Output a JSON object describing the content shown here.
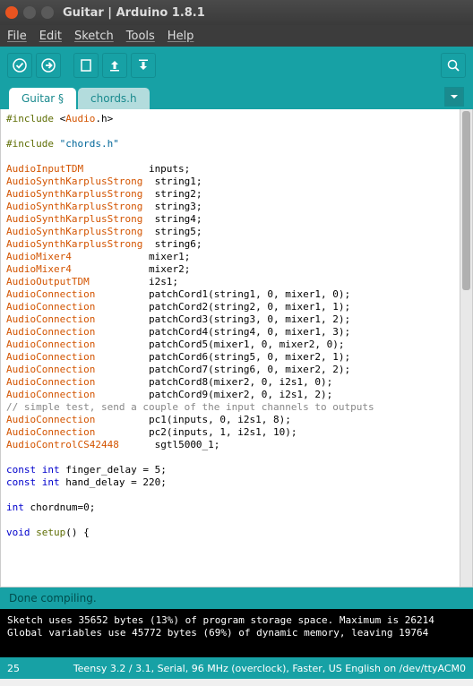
{
  "window": {
    "title": "Guitar | Arduino 1.8.1"
  },
  "menu": {
    "file": "File",
    "edit": "Edit",
    "sketch": "Sketch",
    "tools": "Tools",
    "help": "Help"
  },
  "tabs": {
    "active": "Guitar §",
    "inactive": "chords.h"
  },
  "code": {
    "l1a": "#include",
    "l1b": " <",
    "l1c": "Audio",
    "l1d": ".h>",
    "l2a": "#include",
    "l2b": " ",
    "l2c": "\"chords.h\"",
    "d1a": "AudioInputTDM",
    "d1b": "           inputs;",
    "d2a": "AudioSynthKarplusStrong",
    "d2b": "  string1;",
    "d3a": "AudioSynthKarplusStrong",
    "d3b": "  string2;",
    "d4a": "AudioSynthKarplusStrong",
    "d4b": "  string3;",
    "d5a": "AudioSynthKarplusStrong",
    "d5b": "  string4;",
    "d6a": "AudioSynthKarplusStrong",
    "d6b": "  string5;",
    "d7a": "AudioSynthKarplusStrong",
    "d7b": "  string6;",
    "d8a": "AudioMixer4",
    "d8b": "             mixer1;",
    "d9a": "AudioMixer4",
    "d9b": "             mixer2;",
    "d10a": "AudioOutputTDM",
    "d10b": "          i2s1;",
    "d11a": "AudioConnection",
    "d11b": "         patchCord1(string1, 0, mixer1, 0);",
    "d12a": "AudioConnection",
    "d12b": "         patchCord2(string2, 0, mixer1, 1);",
    "d13a": "AudioConnection",
    "d13b": "         patchCord3(string3, 0, mixer1, 2);",
    "d14a": "AudioConnection",
    "d14b": "         patchCord4(string4, 0, mixer1, 3);",
    "d15a": "AudioConnection",
    "d15b": "         patchCord5(mixer1, 0, mixer2, 0);",
    "d16a": "AudioConnection",
    "d16b": "         patchCord6(string5, 0, mixer2, 1);",
    "d17a": "AudioConnection",
    "d17b": "         patchCord7(string6, 0, mixer2, 2);",
    "d18a": "AudioConnection",
    "d18b": "         patchCord8(mixer2, 0, i2s1, 0);",
    "d19a": "AudioConnection",
    "d19b": "         patchCord9(mixer2, 0, i2s1, 2);",
    "cmt": "// simple test, send a couple of the input channels to outputs",
    "d20a": "AudioConnection",
    "d20b": "         pc1(inputs, 0, i2s1, 8);",
    "d21a": "AudioConnection",
    "d21b": "         pc2(inputs, 1, i2s1, 10);",
    "d22a": "AudioControlCS42448",
    "d22b": "      sgtl5000_1;",
    "c1a": "const",
    "c1b": " ",
    "c1c": "int",
    "c1d": " finger_delay = 5;",
    "c2a": "const",
    "c2b": " ",
    "c2c": "int",
    "c2d": " hand_delay = 220;",
    "c3a": "int",
    "c3b": " chordnum=0;",
    "s1a": "void",
    "s1b": " ",
    "s1c": "setup",
    "s1d": "() {"
  },
  "status": {
    "compile": "Done compiling."
  },
  "console": {
    "l1": "Sketch uses 35652 bytes (13%) of program storage space. Maximum is 26214",
    "l2": "Global variables use 45772 bytes (69%) of dynamic memory, leaving 19764 "
  },
  "statusbar": {
    "line": "25",
    "board": "Teensy 3.2 / 3.1, Serial, 96 MHz (overclock), Faster, US English on /dev/ttyACM0"
  }
}
